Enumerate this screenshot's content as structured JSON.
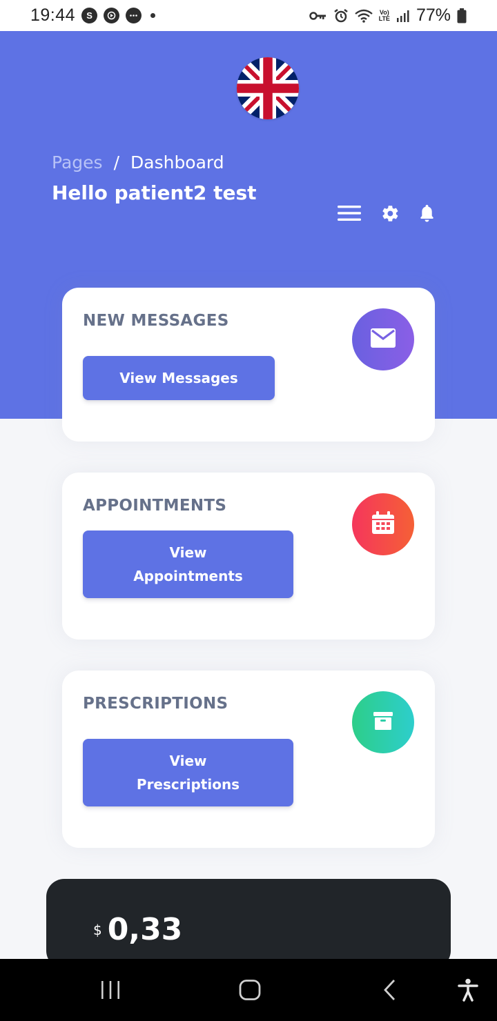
{
  "status_bar": {
    "time": "19:44",
    "app_icons": [
      "S",
      "▶",
      "…"
    ],
    "battery": "77%"
  },
  "header": {
    "language_flag": "uk-flag-icon",
    "breadcrumb": {
      "root": "Pages",
      "separator": "/",
      "current": "Dashboard"
    },
    "greeting": "Hello patient2 test",
    "icons": [
      "menu-icon",
      "gear-icon",
      "bell-icon"
    ]
  },
  "cards": [
    {
      "title": "NEW MESSAGES",
      "button": "View Messages",
      "icon": "envelope-icon",
      "color": "#825ee4"
    },
    {
      "title": "APPOINTMENTS",
      "button_line1": "View",
      "button_line2": "Appointments",
      "icon": "calendar-icon",
      "color": "#f5365c"
    },
    {
      "title": "PRESCRIPTIONS",
      "button_line1": "View",
      "button_line2": "Prescriptions",
      "icon": "archive-icon",
      "color": "#2dce89"
    }
  ],
  "balance": {
    "currency": "$",
    "value": "0,33"
  },
  "colors": {
    "primary": "#5e72e4",
    "dark": "#212529",
    "muted_title": "#66718a"
  }
}
